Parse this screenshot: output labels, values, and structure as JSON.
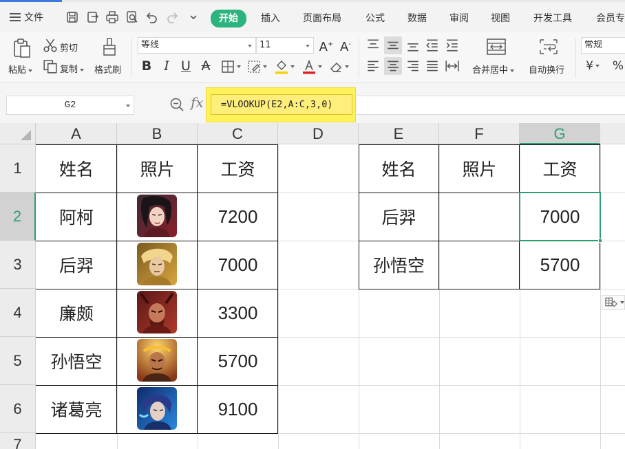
{
  "menu": {
    "file_label": "文件",
    "tabs": [
      "开始",
      "插入",
      "页面布局",
      "公式",
      "数据",
      "审阅",
      "视图",
      "开发工具",
      "会员专"
    ]
  },
  "ribbon": {
    "paste_label": "粘贴",
    "cut_label": "剪切",
    "copy_label": "复制",
    "format_painter_label": "格式刷",
    "font_name": "等线",
    "font_size": "11",
    "merge_center_label": "合并居中",
    "wrap_text_label": "自动换行",
    "number_format": "常规",
    "currency_symbol": "¥",
    "percent_symbol": "%"
  },
  "formula_bar": {
    "name_box": "G2",
    "fx": "fx",
    "formula": "=VLOOKUP(E2,A:C,3,0)"
  },
  "sheet": {
    "columns": [
      "A",
      "B",
      "C",
      "D",
      "E",
      "F",
      "G"
    ],
    "rows": [
      "1",
      "2",
      "3",
      "4",
      "5",
      "6",
      "7"
    ],
    "selected_column": "G",
    "selected_row": "2",
    "left_table": {
      "headers": [
        "姓名",
        "照片",
        "工资"
      ],
      "rows": [
        {
          "name": "阿柯",
          "salary": "7200"
        },
        {
          "name": "后羿",
          "salary": "7000"
        },
        {
          "name": "廉颇",
          "salary": "3300"
        },
        {
          "name": "孙悟空",
          "salary": "5700"
        },
        {
          "name": "诸葛亮",
          "salary": "9100"
        }
      ]
    },
    "right_table": {
      "headers": [
        "姓名",
        "照片",
        "工资"
      ],
      "rows": [
        {
          "name": "后羿",
          "salary": "7000"
        },
        {
          "name": "孙悟空",
          "salary": "5700"
        }
      ]
    }
  },
  "colors": {
    "accent_green": "#2db37d",
    "formula_highlight": "#fff15a"
  }
}
